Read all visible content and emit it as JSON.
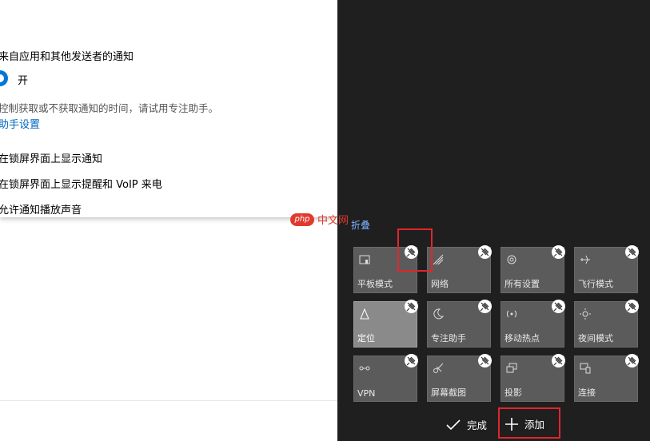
{
  "settings": {
    "heading": "",
    "notify_label": "来自应用和其他发送者的通知",
    "toggle_label": "开",
    "focus_hint": "控制获取或不获取通知的时间，请试用专注助手。",
    "focus_link": "助手设置",
    "lock_screen": "在锁屏界面上显示通知",
    "lock_voip": "在锁屏界面上显示提醒和 VoIP 来电",
    "sounds": "允许通知播放声音"
  },
  "watermark": {
    "logo": "php",
    "text": "中文网"
  },
  "action_center": {
    "collapse_label": "折叠",
    "tiles": [
      {
        "label": "平板模式",
        "icon": "tablet-mode-icon",
        "active": false
      },
      {
        "label": "网络",
        "icon": "network-icon",
        "active": false
      },
      {
        "label": "所有设置",
        "icon": "settings-gear-icon",
        "active": false
      },
      {
        "label": "飞行模式",
        "icon": "airplane-icon",
        "active": false
      },
      {
        "label": "定位",
        "icon": "location-icon",
        "active": true
      },
      {
        "label": "专注助手",
        "icon": "moon-icon",
        "active": false
      },
      {
        "label": "移动热点",
        "icon": "hotspot-icon",
        "active": false
      },
      {
        "label": "夜间模式",
        "icon": "brightness-icon",
        "active": false
      },
      {
        "label": "VPN",
        "icon": "vpn-icon",
        "active": false
      },
      {
        "label": "屏幕截图",
        "icon": "snip-icon",
        "active": false
      },
      {
        "label": "投影",
        "icon": "project-icon",
        "active": false
      },
      {
        "label": "连接",
        "icon": "connect-icon",
        "active": false
      }
    ],
    "done_label": "完成",
    "add_label": "添加"
  },
  "colors": {
    "accent": "#0078d7",
    "highlight": "#e0262c",
    "tile": "#5b5b5b",
    "tile_active": "#8a8a8a"
  }
}
